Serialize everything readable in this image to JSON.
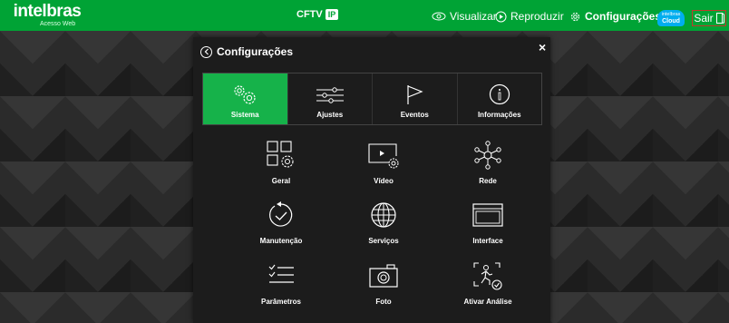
{
  "header": {
    "logo": "intelbras",
    "logo_sub": "Acesso Web",
    "product": "CFTV",
    "product_badge": "IP",
    "nav": {
      "visualizar": "Visualizar",
      "reproduzir": "Reproduzir",
      "configuracoes": "Configurações"
    },
    "cloud_brand": "intelbras",
    "cloud_label": "Cloud",
    "sair": "Sair"
  },
  "modal": {
    "title": "Configurações",
    "close": "×",
    "tabs": [
      {
        "label": "Sistema",
        "icon": "gears-icon",
        "active": true
      },
      {
        "label": "Ajustes",
        "icon": "sliders-icon",
        "active": false
      },
      {
        "label": "Eventos",
        "icon": "flag-icon",
        "active": false
      },
      {
        "label": "Informações",
        "icon": "info-icon",
        "active": false
      }
    ],
    "items": [
      {
        "label": "Geral",
        "icon": "grid-gear-icon"
      },
      {
        "label": "Vídeo",
        "icon": "video-gear-icon"
      },
      {
        "label": "Rede",
        "icon": "network-icon"
      },
      {
        "label": "Manutenção",
        "icon": "maintenance-icon"
      },
      {
        "label": "Serviços",
        "icon": "globe-icon"
      },
      {
        "label": "Interface",
        "icon": "window-icon"
      },
      {
        "label": "Parâmetros",
        "icon": "checklist-icon"
      },
      {
        "label": "Foto",
        "icon": "camera-icon"
      },
      {
        "label": "Ativar Análise",
        "icon": "analysis-icon"
      }
    ]
  },
  "colors": {
    "brand_green": "#00a335",
    "active_tab": "#16b24a",
    "modal_bg": "#1c1c1c",
    "sair_border": "#c0392b",
    "cloud_blue": "#00aeef"
  }
}
